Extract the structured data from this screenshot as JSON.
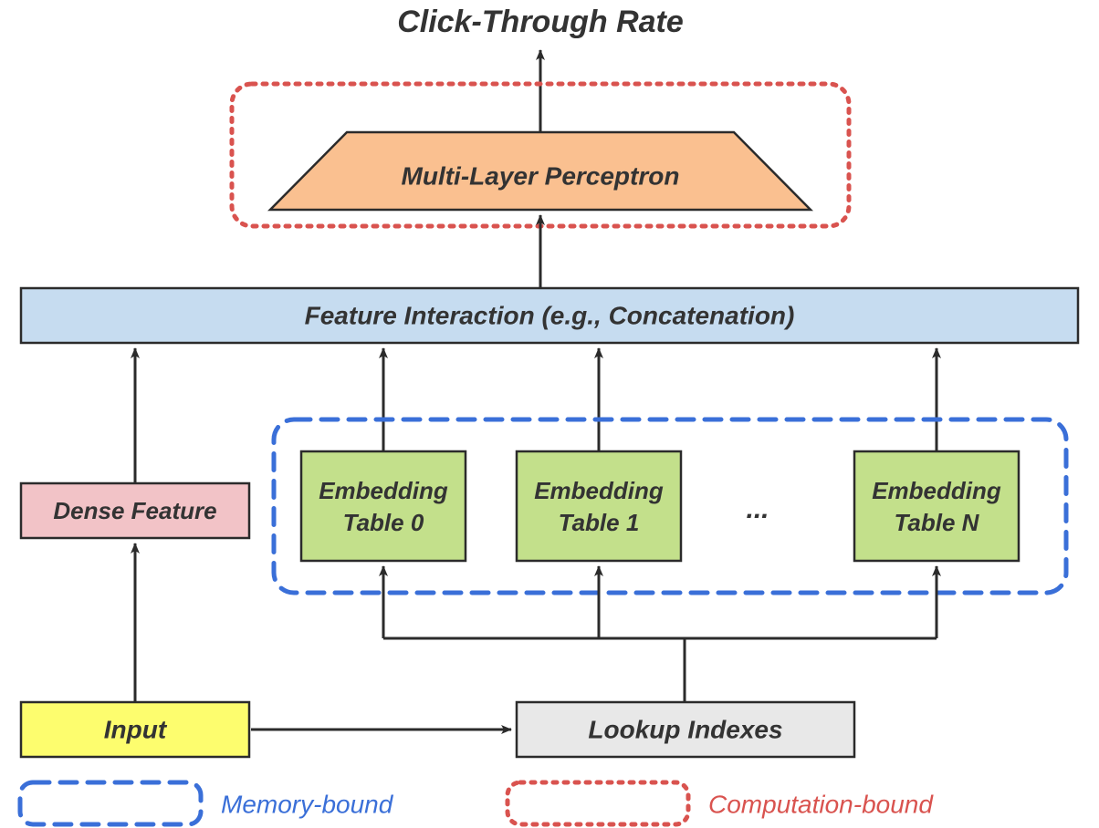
{
  "title": "Click-Through Rate",
  "mlp": "Multi-Layer Perceptron",
  "feature_interaction": "Feature Interaction (e.g., Concatenation)",
  "dense_feature": "Dense Feature",
  "embedding_prefix": "Embedding",
  "embed0": "Table 0",
  "embed1": "Table 1",
  "embedN": "Table N",
  "ellipsis": "...",
  "input": "Input",
  "lookup": "Lookup Indexes",
  "legend_memory": "Memory-bound",
  "legend_compute": "Computation-bound",
  "colors": {
    "mlp_fill": "#fac090",
    "feature_fill": "#c6dcf0",
    "dense_fill": "#f2c3c7",
    "embed_fill": "#c3e08b",
    "input_fill": "#fdfd6e",
    "lookup_fill": "#e8e8e8",
    "mem_border": "#3a6fd8",
    "comp_border": "#d9534f",
    "mem_text": "#3a6fd8",
    "comp_text": "#d9534f",
    "stroke": "#2b2b2b",
    "title": "#3a3a3a"
  }
}
